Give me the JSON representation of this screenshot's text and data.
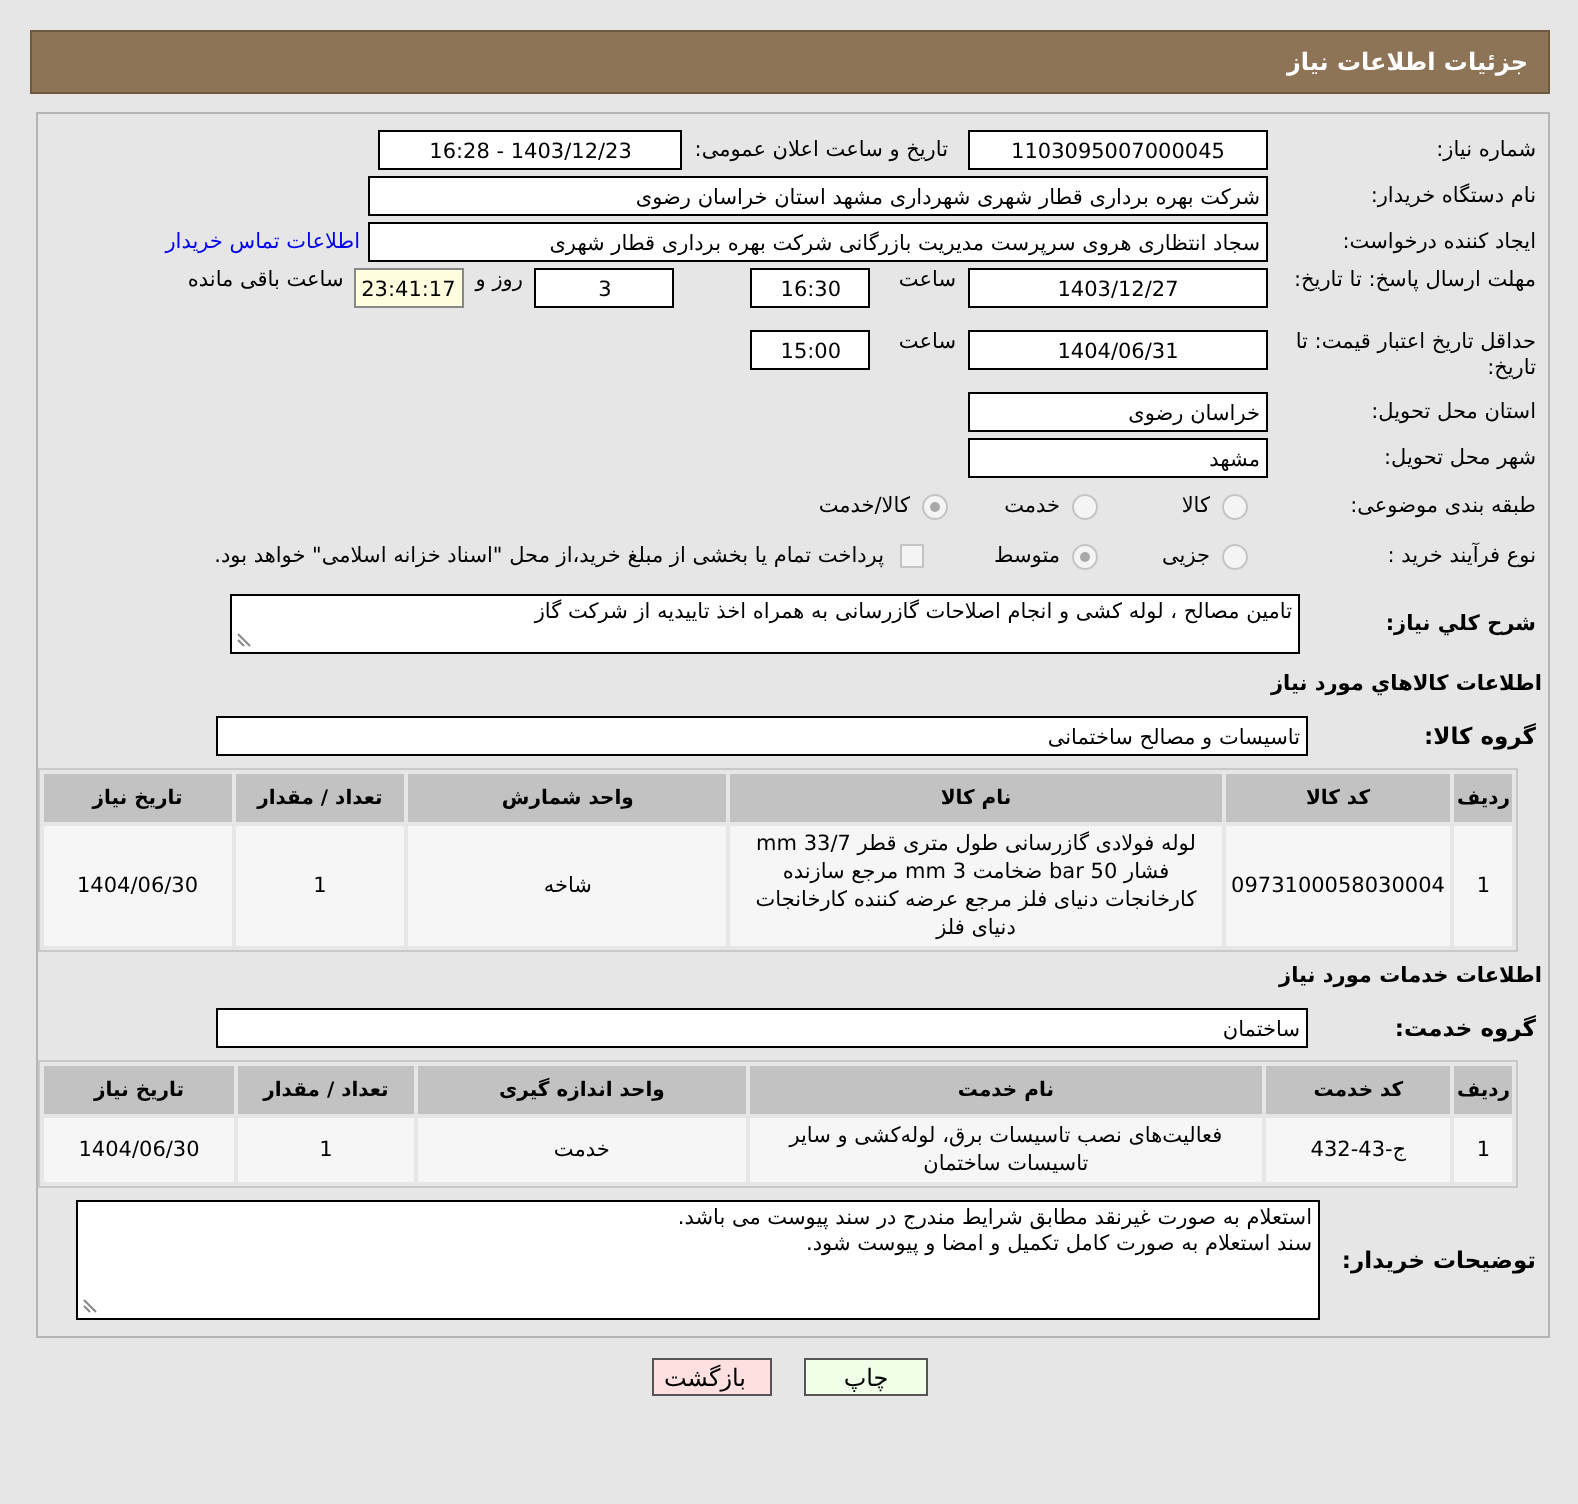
{
  "header": {
    "title": "جزئیات اطلاعات نیاز"
  },
  "need_number": {
    "label": "شماره نیاز:",
    "value": "1103095007000045"
  },
  "announce": {
    "label": "تاریخ و ساعت اعلان عمومی:",
    "value": "1403/12/23 - 16:28"
  },
  "buyer": {
    "label": "نام دستگاه خریدار:",
    "value": "شرکت بهره برداری قطار شهری شهرداری مشهد استان خراسان رضوی"
  },
  "requester": {
    "label": "ایجاد کننده درخواست:",
    "value": "سجاد انتظاری هروی سرپرست مدیریت بازرگانی شرکت بهره برداری قطار شهری",
    "link": "اطلاعات تماس خریدار"
  },
  "reply_deadline": {
    "label": "مهلت ارسال پاسخ: تا تاریخ:",
    "date": "1403/12/27",
    "time_label": "ساعت",
    "time": "16:30",
    "days": "3",
    "days_label": "روز و",
    "remaining": "23:41:17",
    "remaining_label": "ساعت باقی مانده"
  },
  "price_validity": {
    "label": "حداقل تاریخ اعتبار قیمت: تا تاریخ:",
    "date": "1404/06/31",
    "time_label": "ساعت",
    "time": "15:00"
  },
  "province": {
    "label": "استان محل تحویل:",
    "value": "خراسان رضوی"
  },
  "city": {
    "label": "شهر محل تحویل:",
    "value": "مشهد"
  },
  "category": {
    "label": "طبقه بندی موضوعی:",
    "options": [
      {
        "label": "کالا",
        "selected": false
      },
      {
        "label": "خدمت",
        "selected": false
      },
      {
        "label": "کالا/خدمت",
        "selected": true
      }
    ]
  },
  "purchase_type": {
    "label": "نوع فرآیند خرید :",
    "options": [
      {
        "label": "جزیی",
        "selected": false
      },
      {
        "label": "متوسط",
        "selected": true
      }
    ],
    "payment": {
      "text": "پرداخت تمام یا بخشی از مبلغ خرید،از محل \"اسناد خزانه اسلامی\" خواهد بود.",
      "checked": false
    }
  },
  "description": {
    "label": "شرح کلي نیاز:",
    "value": "تامین مصالح ، لوله کشی و انجام اصلاحات گازرسانی به همراه اخذ تاییدیه از شرکت گاز"
  },
  "goods": {
    "title": "اطلاعات کالاهاي مورد نیاز",
    "group_label": "گروه کالا:",
    "group": "تاسیسات و مصالح ساختمانی",
    "columns": [
      "ردیف",
      "کد کالا",
      "نام کالا",
      "واحد شمارش",
      "تعداد / مقدار",
      "تاریخ نیاز"
    ],
    "rows": [
      [
        "1",
        "0973100058030004",
        "لوله فولادی گازرسانی طول متری قطر 33/7 mm فشار 50 bar ضخامت 3 mm مرجع سازنده کارخانجات دنیای فلز مرجع عرضه کننده کارخانجات دنیای فلز",
        "شاخه",
        "1",
        "1404/06/30"
      ]
    ]
  },
  "services": {
    "title": "اطلاعات خدمات مورد نیاز",
    "group_label": "گروه خدمت:",
    "group": "ساختمان",
    "columns": [
      "ردیف",
      "کد خدمت",
      "نام خدمت",
      "واحد اندازه گیری",
      "تعداد / مقدار",
      "تاریخ نیاز"
    ],
    "rows": [
      [
        "1",
        "ج-43-432",
        "فعالیت‌های نصب تاسیسات برق، لوله‌کشی و سایر تاسیسات ساختمان",
        "خدمت",
        "1",
        "1404/06/30"
      ]
    ]
  },
  "buyer_notes": {
    "label": "توضیحات خریدار:",
    "value": "استعلام به صورت غیرنقد مطابق شرایط مندرج در سند پیوست می باشد.\nسند استعلام به صورت کامل تکمیل و امضا و پیوست شود."
  },
  "buttons": [
    {
      "label": "چاپ",
      "kind": "print"
    },
    {
      "label": "بازگشت",
      "kind": "back"
    }
  ]
}
